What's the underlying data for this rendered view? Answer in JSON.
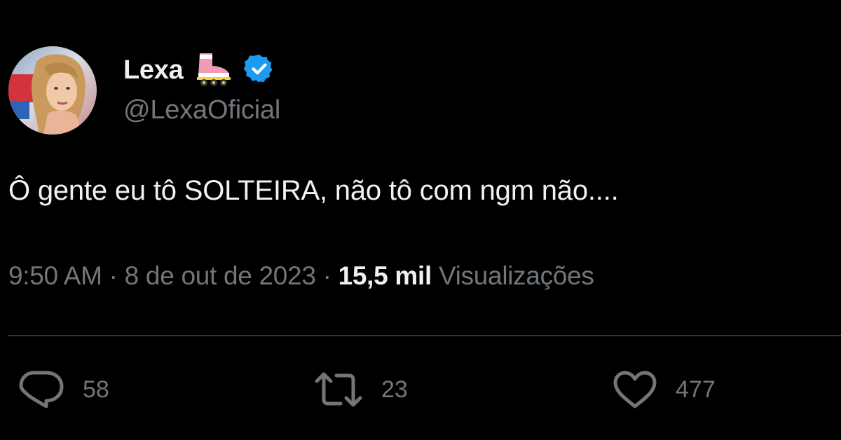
{
  "user": {
    "display_name": "Lexa",
    "handle": "@LexaOficial",
    "verified": true,
    "name_emoji": "roller-skate-icon",
    "avatar": "profile-photo"
  },
  "tweet": {
    "text": "Ô gente eu tô SOLTEIRA, não tô com ngm não....",
    "time": "9:50 AM",
    "separator": "·",
    "date": "8 de out de 2023",
    "views_count": "15,5 mil",
    "views_label": "Visualizações"
  },
  "actions": {
    "replies": "58",
    "retweets": "23",
    "likes": "477"
  },
  "colors": {
    "background": "#000000",
    "text_primary": "#f1f1f1",
    "text_secondary": "#71767b",
    "verified_blue": "#1d9bf0",
    "divider": "#2f3336"
  }
}
